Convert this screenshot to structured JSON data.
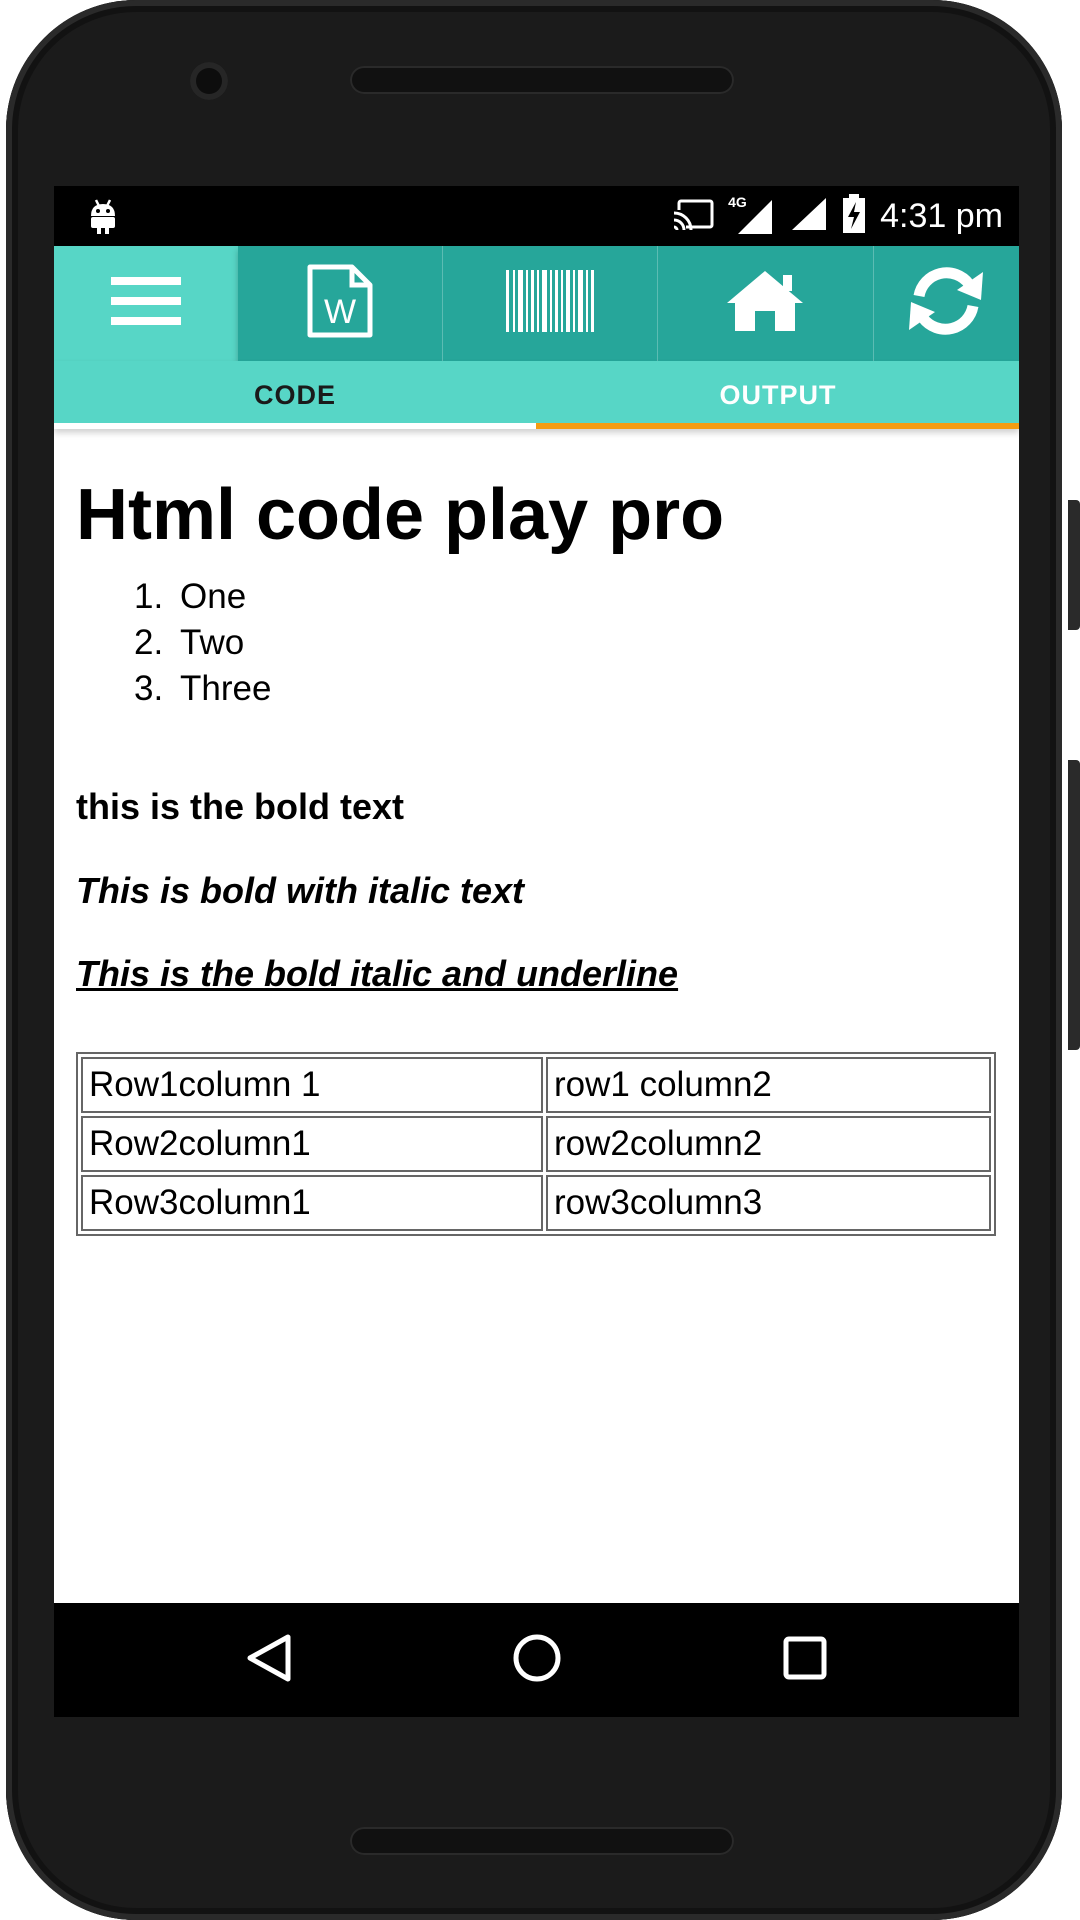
{
  "status_bar": {
    "time": "4:31 pm",
    "network": "4G",
    "icons": [
      "android-notification-icon",
      "cast-icon",
      "signal-4g-icon",
      "signal-icon",
      "battery-charging-icon"
    ]
  },
  "app_bar": {
    "menu_icon": "hamburger-menu-icon",
    "toolbar_icons": [
      "word-document-icon",
      "barcode-icon",
      "home-icon",
      "refresh-icon"
    ]
  },
  "tabs": [
    {
      "label": "CODE"
    },
    {
      "label": "OUTPUT"
    }
  ],
  "output": {
    "heading": "Html code play pro",
    "list": [
      {
        "num": "1.",
        "text": "One"
      },
      {
        "num": "2.",
        "text": "Two"
      },
      {
        "num": "3.",
        "text": "Three"
      }
    ],
    "bold_text": "this is the bold text",
    "bold_italic_text": "This is bold with italic text",
    "bold_italic_underline_text": "This is the bold italic and underline",
    "table": [
      [
        "Row1column 1",
        "row1 column2"
      ],
      [
        "Row2column1",
        "row2column2"
      ],
      [
        "Row3column1",
        "row3column3"
      ]
    ]
  },
  "nav_bar": {
    "icons": [
      "back-icon",
      "home-circle-icon",
      "recents-icon"
    ]
  },
  "colors": {
    "appbar": "#57d6c6",
    "toolbar": "#26a69a",
    "tab_indicator": "#f39c12"
  }
}
